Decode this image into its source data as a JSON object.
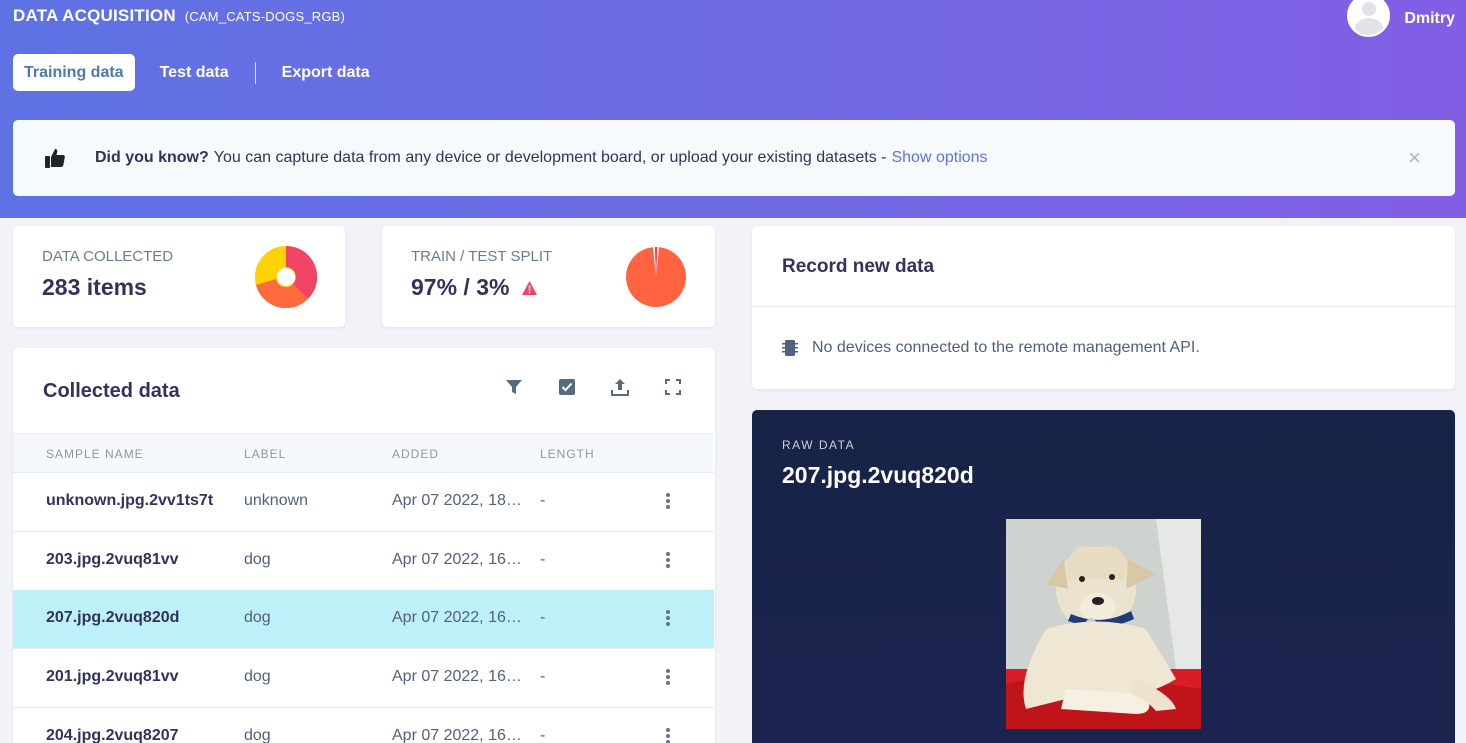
{
  "header": {
    "title": "DATA ACQUISITION",
    "subtitle": "(CAM_CATS-DOGS_RGB)",
    "user_name": "Dmitry"
  },
  "tabs": [
    {
      "label": "Training data",
      "active": true
    },
    {
      "label": "Test data",
      "active": false
    },
    {
      "label": "Export data",
      "active": false
    }
  ],
  "tip": {
    "icon": "thumbs-up-icon",
    "bold": "Did you know?",
    "text": "You can capture data from any device or development board, or upload your existing datasets -",
    "link": "Show options",
    "close": "×"
  },
  "stats": {
    "data_collected": {
      "label": "DATA COLLECTED",
      "value": "283 items",
      "donut_colors": [
        "#ef4466",
        "#ff6b3d",
        "#ffd200"
      ]
    },
    "train_test_split": {
      "label": "TRAIN / TEST SPLIT",
      "value": "97% / 3%",
      "warning_icon": "warning-icon",
      "split": [
        97,
        3
      ],
      "colors": [
        "#ff6340",
        "#ef4466"
      ]
    }
  },
  "collected": {
    "title": "Collected data",
    "toolbar_icons": [
      "filter-icon",
      "checkbox-icon",
      "upload-icon",
      "fullscreen-icon"
    ],
    "columns": [
      "SAMPLE NAME",
      "LABEL",
      "ADDED",
      "LENGTH"
    ],
    "rows": [
      {
        "name": "unknown.jpg.2vv1ts7t",
        "label": "unknown",
        "added": "Apr 07 2022, 18:…",
        "length": "-",
        "selected": false
      },
      {
        "name": "203.jpg.2vuq81vv",
        "label": "dog",
        "added": "Apr 07 2022, 16:…",
        "length": "-",
        "selected": false
      },
      {
        "name": "207.jpg.2vuq820d",
        "label": "dog",
        "added": "Apr 07 2022, 16:…",
        "length": "-",
        "selected": true
      },
      {
        "name": "201.jpg.2vuq81vv",
        "label": "dog",
        "added": "Apr 07 2022, 16:…",
        "length": "-",
        "selected": false
      },
      {
        "name": "204.jpg.2vuq8207",
        "label": "dog",
        "added": "Apr 07 2022, 16:…",
        "length": "-",
        "selected": false
      }
    ]
  },
  "record": {
    "title": "Record new data",
    "icon": "device-chip-icon",
    "message": "No devices connected to the remote management API."
  },
  "raw": {
    "label": "RAW DATA",
    "filename": "207.jpg.2vuq820d"
  }
}
